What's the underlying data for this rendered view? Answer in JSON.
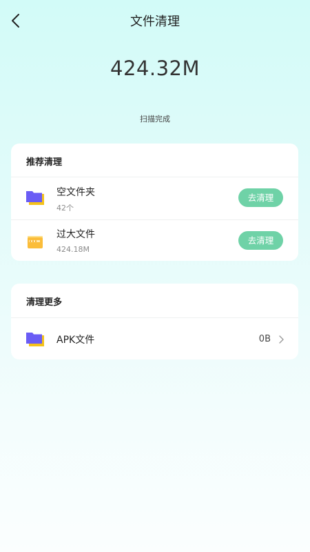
{
  "header": {
    "title": "文件清理",
    "back_icon": "chevron-left-icon"
  },
  "summary": {
    "total_size": "424.32M",
    "status": "扫描完成"
  },
  "recommend": {
    "title": "推荐清理",
    "items": [
      {
        "name": "空文件夹",
        "detail": "42个",
        "action": "去清理",
        "icon": "purple-folder-icon"
      },
      {
        "name": "过大文件",
        "detail": "424.18M",
        "action": "去清理",
        "icon": "orange-file-box-icon"
      }
    ]
  },
  "more": {
    "title": "清理更多",
    "items": [
      {
        "name": "APK文件",
        "size": "0B",
        "icon": "purple-folder-icon",
        "trailing_icon": "chevron-right-icon"
      }
    ]
  },
  "colors": {
    "accent_button": "#6fd2a7",
    "folder_purple": "#6a5cf5",
    "folder_yellow": "#f5c21a",
    "file_orange": "#fbbd3a"
  }
}
